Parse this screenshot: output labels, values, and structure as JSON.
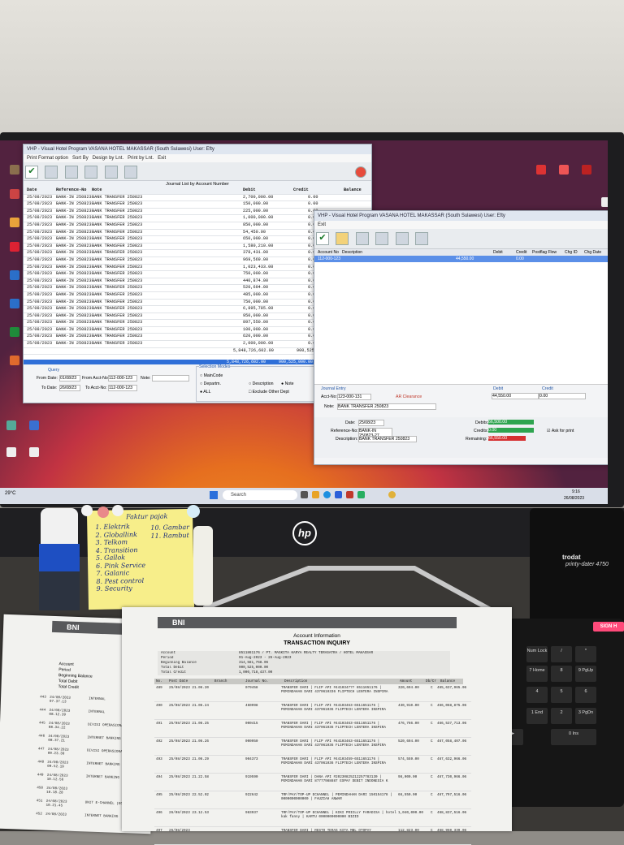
{
  "left_window": {
    "title": "VHP - Visual Hotel Program      VASANA HOTEL MAKASSAR (South Sulawesi) User: Efty",
    "menu": [
      "Print Format option",
      "Sort By",
      "Design by Lnt.",
      "Print by Lnt.",
      "Exit"
    ],
    "report_title": "Journal List by Account Number",
    "columns": {
      "date": "Date",
      "ref": "Reference-No",
      "note": "Note",
      "debit": "Debit",
      "credit": "Credit",
      "balance": "Balance"
    },
    "rows": [
      {
        "date": "25/08/2023",
        "ref": "BANK-IN 250823",
        "note": "BANK TRANSFER 250823",
        "debit": "2,700,000.00",
        "credit": "0.00"
      },
      {
        "date": "25/08/2023",
        "ref": "BANK-IN 250823",
        "note": "BANK TRANSFER 250823",
        "debit": "150,000.00",
        "credit": "0.00"
      },
      {
        "date": "25/08/2023",
        "ref": "BANK-IN 250823",
        "note": "BANK TRANSFER 250823",
        "debit": "225,000.00",
        "credit": "0.00"
      },
      {
        "date": "25/08/2023",
        "ref": "BANK-IN 250823",
        "note": "BANK TRANSFER 250823",
        "debit": "1,000,000.00",
        "credit": "0.00"
      },
      {
        "date": "25/08/2023",
        "ref": "BANK-IN 250823",
        "note": "BANK TRANSFER 250823",
        "debit": "850,000.00",
        "credit": "0.00"
      },
      {
        "date": "25/08/2023",
        "ref": "BANK-IN 250823",
        "note": "BANK TRANSFER 250823",
        "debit": "54,450.00",
        "credit": "0.00"
      },
      {
        "date": "25/08/2023",
        "ref": "BANK-IN 250823",
        "note": "BANK TRANSFER 250823",
        "debit": "650,000.00",
        "credit": "0.00"
      },
      {
        "date": "25/08/2023",
        "ref": "BANK-IN 250823",
        "note": "BANK TRANSFER 250823",
        "debit": "1,580,210.00",
        "credit": "0.00"
      },
      {
        "date": "25/08/2023",
        "ref": "BANK-IN 250823",
        "note": "BANK TRANSFER 250823",
        "debit": "378,431.00",
        "credit": "0.00"
      },
      {
        "date": "25/08/2023",
        "ref": "BANK-IN 250823",
        "note": "BANK TRANSFER 250823",
        "debit": "969,569.00",
        "credit": "0.00"
      },
      {
        "date": "25/08/2023",
        "ref": "BANK-IN 250823",
        "note": "BANK TRANSFER 250823",
        "debit": "1,023,433.00",
        "credit": "0.00"
      },
      {
        "date": "25/08/2023",
        "ref": "BANK-IN 250823",
        "note": "BANK TRANSFER 250823",
        "debit": "750,000.00",
        "credit": "0.00"
      },
      {
        "date": "25/08/2023",
        "ref": "BANK-IN 250823",
        "note": "BANK TRANSFER 250823",
        "debit": "440,874.00",
        "credit": "0.00"
      },
      {
        "date": "25/08/2023",
        "ref": "BANK-IN 250823",
        "note": "BANK TRANSFER 250823",
        "debit": "520,694.00",
        "credit": "0.00"
      },
      {
        "date": "25/08/2023",
        "ref": "BANK-IN 250823",
        "note": "BANK TRANSFER 250823",
        "debit": "485,000.00",
        "credit": "0.00"
      },
      {
        "date": "25/08/2023",
        "ref": "BANK-IN 250823",
        "note": "BANK TRANSFER 250823",
        "debit": "750,000.00",
        "credit": "0.00"
      },
      {
        "date": "25/08/2023",
        "ref": "BANK-IN 250823",
        "note": "BANK TRANSFER 250823",
        "debit": "6,895,785.00",
        "credit": "0.00"
      },
      {
        "date": "25/08/2023",
        "ref": "BANK-IN 250823",
        "note": "BANK TRANSFER 250823",
        "debit": "950,000.00",
        "credit": "0.00"
      },
      {
        "date": "25/08/2023",
        "ref": "BANK-IN 250823",
        "note": "BANK TRANSFER 250823",
        "debit": "897,550.00",
        "credit": "0.00"
      },
      {
        "date": "25/08/2023",
        "ref": "BANK-IN 250823",
        "note": "BANK TRANSFER 250823",
        "debit": "100,000.00",
        "credit": "0.00"
      },
      {
        "date": "25/08/2023",
        "ref": "BANK-IN 250823",
        "note": "BANK TRANSFER 250823",
        "debit": "620,000.00",
        "credit": "0.00"
      },
      {
        "date": "25/08/2023",
        "ref": "BANK-IN 250823",
        "note": "BANK TRANSFER 250823",
        "debit": "2,000,000.00",
        "credit": "0.00"
      },
      {
        "date": "",
        "ref": "",
        "note": "",
        "debit": "5,848,726,602.00",
        "credit": "900,525,000.00"
      }
    ],
    "total": {
      "debit": "5,848,726,602.00",
      "credit": "900,525,000.00"
    },
    "query": {
      "label": "Query",
      "from_date_label": "From Date:",
      "from_date": "01/08/23",
      "to_date_label": "To Date:",
      "to_date": "26/08/23",
      "from_acct_label": "From Acct-No:",
      "from_acct": "112-000-123",
      "to_acct_label": "To Acct-No:",
      "to_acct": "112-000-123",
      "note_label": "Note:",
      "selection_label": "Selection Modes",
      "options": [
        "MainCode",
        "Departm.",
        "ALL",
        "Description",
        "Note",
        "Exclude Other Dept"
      ]
    }
  },
  "right_window": {
    "title": "VHP - Visual Hotel Program      VASANA HOTEL MAKASSAR (South Sulawesi) User: Efty",
    "menu": "Exit",
    "header": {
      "account_no": "Account No",
      "description": "Description",
      "debit": "Debit",
      "credit": "Credit",
      "posting_flag": "Postflag Flow",
      "chg": "Chg ID",
      "chg_date": "Chg Date"
    },
    "selected_row": {
      "account": "112-000-123",
      "debit": "44,550.00",
      "credit": "0.00"
    },
    "journal_entry": {
      "label": "Journal Entry",
      "acct_no_label": "Acct-No:",
      "acct_no": "123-000-131",
      "ar_label": "AR Clearance",
      "note_label": "Note:",
      "note": "BANK TRANSFER 250823",
      "debit_label": "Debit",
      "debit": "44,550.00",
      "credit_label": "Credit",
      "credit": "0.00"
    },
    "footer": {
      "date_label": "Date:",
      "date": "25/08/23",
      "ref_label": "Reference-No:",
      "ref": "BANK-IN 250823-27",
      "desc_label": "Description:",
      "desc": "BANK TRANSFER 250823",
      "debits_label": "Debits:",
      "debits": "66,500.00",
      "credits_label": "Credits:",
      "credits": "0.00",
      "remaining_label": "Remaining:",
      "remaining": "66,550.00",
      "ask_label": "Ask for print"
    }
  },
  "taskbar": {
    "search": "Search",
    "weather": "29°C",
    "date": "26/08/2023",
    "time": "9:16"
  },
  "monitor": {
    "brand": "hp"
  },
  "sticky_note": {
    "title": "Faktur pajak",
    "items": [
      "1. Elektrik",
      "2. Globallink",
      "3. Telkom",
      "4. Transition",
      "5. Gallok",
      "6. Pink Service",
      "7. Galanic",
      "8. Pest control",
      "9. Security"
    ],
    "side": [
      "10. Gambar",
      "11. Rambut"
    ]
  },
  "paper_front": {
    "bank": "BNI",
    "title": "Account Information",
    "subtitle": "TRANSACTION INQUIRY",
    "fields": [
      {
        "label": "Account",
        "value": "8511861176 / PT. MASKITA KARYA REALTY TERASATRA / HOTEL MAKASSAR"
      },
      {
        "label": "Period",
        "value": "01-Aug-2023   -   26-Aug-2023"
      },
      {
        "label": "Beginning Balance",
        "value": "314,581,768.06"
      },
      {
        "label": "Total Debit",
        "value": "900,525,000.00"
      },
      {
        "label": "Total Credit",
        "value": "1,000,718,437.00"
      }
    ],
    "columns": [
      "No.",
      "Post Date",
      "Branch",
      "Journal No.",
      "Description",
      "Amount",
      "Db/Cr",
      "Balance"
    ],
    "rows": [
      {
        "no": "489",
        "date": "25/08/2023 21.06.20",
        "journal": "079458",
        "desc": "TRANSFER DARI | FLIP API #4410347?? 6511651176 | PEMINDAHAN DARI 4370610336 FLIPTECH LENTERA INSPIRA",
        "amount": "320,694.00",
        "dc": "C",
        "bal": "465,637,965.06"
      },
      {
        "no": "490",
        "date": "25/08/2023 21.06.24",
        "journal": "460998",
        "desc": "TRANSFER DARI | FLIP API #44103463-6511651176 | PEMINDAHAN DARI 437061036 FLIPTECH LENTERA INSPIRA",
        "amount": "430,910.00",
        "dc": "C",
        "bal": "466,068,875.06"
      },
      {
        "no": "491",
        "date": "25/08/2023 21.06.25",
        "journal": "000415",
        "desc": "TRANSFER DARI | FLIP API #44103463-6511651176 | PEMINDAHAN DARI 437061036 FLIPTECH LENTERA INSPIRA",
        "amount": "476,766.00",
        "dc": "C",
        "bal": "466,537,713.06"
      },
      {
        "no": "492",
        "date": "25/08/2023 21.06.26",
        "journal": "000950",
        "desc": "TRANSFER DARI | FLIP API #44103463-6511651176 | PEMINDAHAN DARI 437061036 FLIPTECH LENTERA INSPIRA",
        "amount": "520,694.00",
        "dc": "C",
        "bal": "467,058,407.06"
      },
      {
        "no": "493",
        "date": "25/08/2023 21.06.29",
        "journal": "904373",
        "desc": "TRANSFER DARI | FLIP API #44103459-6511651176 | PEMINDAHAN DARI 437061036 FLIPTECH LENTERA INSPIRA",
        "amount": "574,559.00",
        "dc": "C",
        "bal": "467,632,966.06"
      },
      {
        "no": "494",
        "date": "25/08/2023 21.22.58",
        "journal": "919590",
        "desc": "TRANSFER DARI | DANA API #20230825212257783130 | PEMINDAHAN DARI 87777988887 ESPAY DEBIT INDONESIA K",
        "amount": "98,000.00",
        "dc": "C",
        "bal": "467,730,966.06"
      },
      {
        "no": "495",
        "date": "25/08/2023 22.52.02",
        "journal": "922642",
        "desc": "TRF/PAY/TOP-UP ECHANNEL | PEMINDAHAN DARI 150154178 | 0000000000000 | FAUZIAH ANWAR",
        "amount": "66,550.00",
        "dc": "C",
        "bal": "467,797,516.06"
      },
      {
        "no": "496",
        "date": "26/08/2023 23.12.53",
        "journal": "983937",
        "desc": "TRF/PAY/TOP-UP ECHANNEL | KIKI PRIILLY FARADISA | hotel kak fanny | KARTU 0000000000000 BIZID",
        "amount": "1,040,000.00",
        "dc": "C",
        "bal": "468,837,516.06"
      },
      {
        "no": "497",
        "date": "26/08/2023",
        "journal": "",
        "desc": "TRANSFER DARI | RESTO TERAS KITA MBL OTOPAY",
        "amount": "112,823.00",
        "dc": "C",
        "bal": "468,950,339.06"
      }
    ]
  },
  "paper_back": {
    "bank": "BNI",
    "labels": [
      "Account",
      "Period",
      "Beginning Balance",
      "Total Debit",
      "Total Credit"
    ],
    "entries": [
      {
        "no": "443",
        "date": "24/08/2023 07.37.13",
        "branch": "INTERNAL"
      },
      {
        "no": "444",
        "date": "24/08/2023 08.12.39",
        "branch": "INTERNAL"
      },
      {
        "no": "445",
        "date": "24/08/2023 08.34.22",
        "branch": "DIVISI OPERASIONAL"
      },
      {
        "no": "446",
        "date": "24/08/2023 08.37.21",
        "branch": "INTERNET BANKING"
      },
      {
        "no": "447",
        "date": "24/08/2023 09.23.30",
        "branch": "DIVISI OPERASIONAL"
      },
      {
        "no": "448",
        "date": "24/08/2023 09.52.19",
        "branch": "INTERNET BANKING"
      },
      {
        "no": "449",
        "date": "24/08/2023 10.12.56",
        "branch": "INTERNET BANKING"
      },
      {
        "no": "450",
        "date": "24/08/2023 10.18.28",
        "branch": ""
      },
      {
        "no": "451",
        "date": "24/08/2023 10.21.45",
        "branch": "UNIT E-CHANNEL (ECH)"
      },
      {
        "no": "452",
        "date": "24/08/2023",
        "branch": "INTERNET BANKING"
      }
    ]
  },
  "stamp": {
    "brand": "trodat",
    "model": "printy-dater 4750"
  },
  "sign_tab": "SIGN H"
}
